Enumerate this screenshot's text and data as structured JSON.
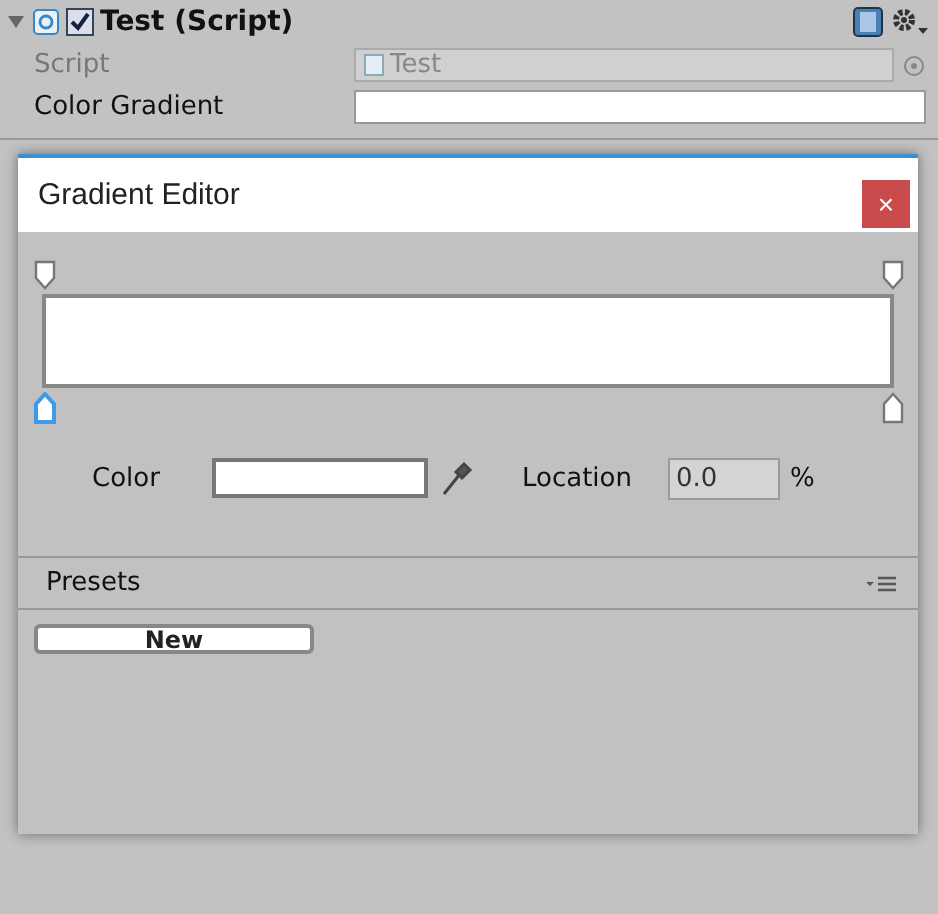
{
  "inspector": {
    "component": {
      "expanded": true,
      "enabled": true,
      "title": "Test (Script)"
    },
    "fields": [
      {
        "kind": "script",
        "label": "Script",
        "disabled": true,
        "value": "Test"
      },
      {
        "kind": "gradient",
        "label": "Color Gradient",
        "disabled": false
      }
    ]
  },
  "dialog": {
    "title": "Gradient Editor",
    "close": "×",
    "gradient": {
      "alpha_keys": [
        {
          "selected": false
        },
        {
          "selected": false
        }
      ],
      "color_keys": [
        {
          "selected": true
        },
        {
          "selected": false
        }
      ]
    },
    "color": {
      "label": "Color",
      "color": "#ffffff"
    },
    "location": {
      "label": "Location",
      "value": "0.0",
      "unit": "%"
    },
    "presets": {
      "title": "Presets",
      "buttons": [
        "New"
      ]
    }
  }
}
